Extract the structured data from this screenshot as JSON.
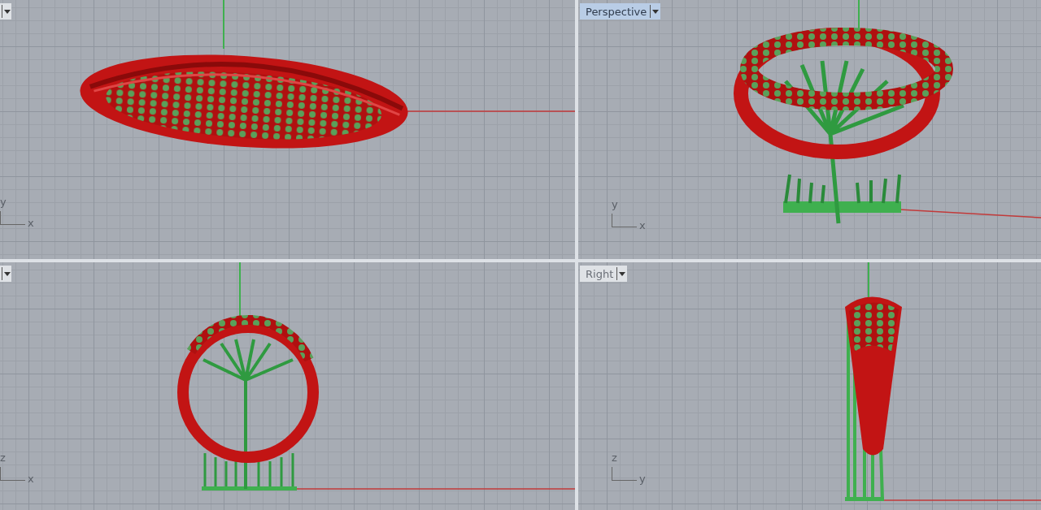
{
  "viewports": [
    {
      "kind": "top",
      "selected": false,
      "axes": {
        "vertical": "y",
        "horizontal": "x"
      }
    },
    {
      "kind": "perspective",
      "label": "Perspective",
      "selected": true,
      "axes": {
        "vertical": "y",
        "horizontal": "x"
      }
    },
    {
      "kind": "front",
      "selected": false,
      "axes": {
        "vertical": "z",
        "horizontal": "x"
      }
    },
    {
      "kind": "right",
      "label": "Right",
      "selected": false,
      "axes": {
        "vertical": "z",
        "horizontal": "y"
      }
    }
  ]
}
